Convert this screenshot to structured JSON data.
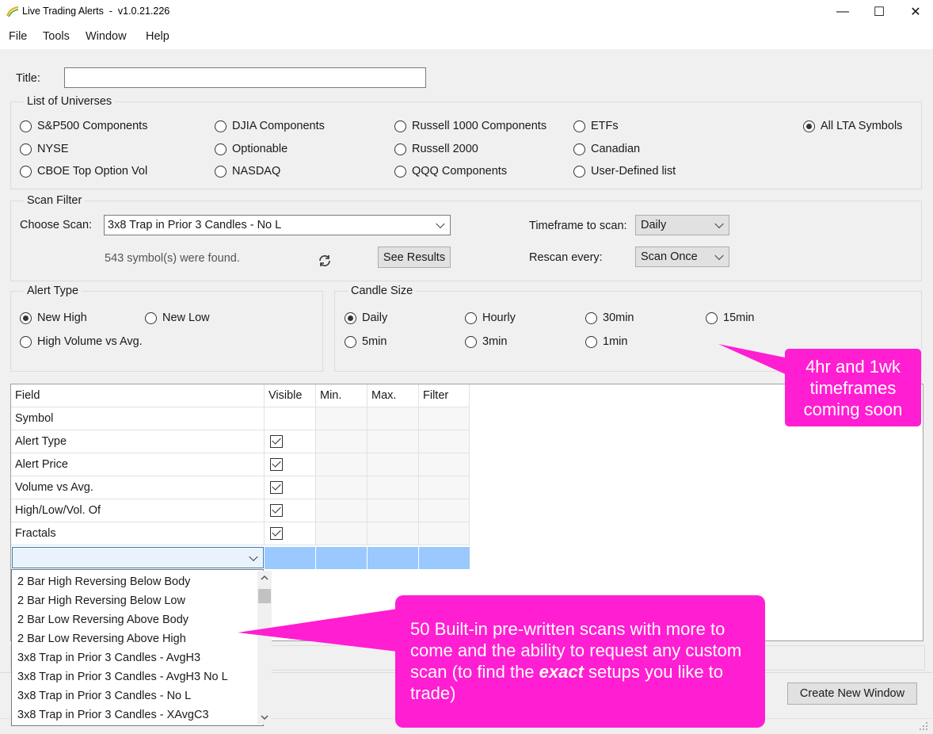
{
  "window": {
    "title": "Live Trading Alerts  -  v1.0.21.226",
    "controls": {
      "minimize": "—",
      "maximize": "☐",
      "close": "✕"
    }
  },
  "menu": [
    "File",
    "Tools",
    "Window",
    "Help"
  ],
  "title_field": {
    "label": "Title:",
    "value": ""
  },
  "universes": {
    "legend": "List of Universes",
    "options": [
      {
        "label": "S&P500 Components",
        "selected": false
      },
      {
        "label": "NYSE",
        "selected": false
      },
      {
        "label": "CBOE Top Option Vol",
        "selected": false
      },
      {
        "label": "DJIA Components",
        "selected": false
      },
      {
        "label": "Optionable",
        "selected": false
      },
      {
        "label": "NASDAQ",
        "selected": false
      },
      {
        "label": "Russell 1000 Components",
        "selected": false
      },
      {
        "label": "Russell 2000",
        "selected": false
      },
      {
        "label": "QQQ Components",
        "selected": false
      },
      {
        "label": "ETFs",
        "selected": false
      },
      {
        "label": "Canadian",
        "selected": false
      },
      {
        "label": "User-Defined list",
        "selected": false
      },
      {
        "label": "All LTA Symbols",
        "selected": true
      }
    ]
  },
  "scan_filter": {
    "legend": "Scan Filter",
    "choose_label": "Choose Scan:",
    "choose_value": "3x8 Trap in Prior 3 Candles - No L",
    "found_text": "543 symbol(s) were found.",
    "see_results": "See Results",
    "timeframe_label": "Timeframe to scan:",
    "timeframe_value": "Daily",
    "rescan_label": "Rescan every:",
    "rescan_value": "Scan Once"
  },
  "alert_type": {
    "legend": "Alert Type",
    "options": [
      {
        "label": "New High",
        "selected": true
      },
      {
        "label": "New Low",
        "selected": false
      },
      {
        "label": "High Volume vs Avg.",
        "selected": false
      }
    ]
  },
  "candle_size": {
    "legend": "Candle Size",
    "options": [
      {
        "label": "Daily",
        "selected": true
      },
      {
        "label": "Hourly",
        "selected": false
      },
      {
        "label": "30min",
        "selected": false
      },
      {
        "label": "15min",
        "selected": false
      },
      {
        "label": "5min",
        "selected": false
      },
      {
        "label": "3min",
        "selected": false
      },
      {
        "label": "1min",
        "selected": false
      }
    ]
  },
  "grid": {
    "headers": [
      "Field",
      "Visible",
      "Min.",
      "Max.",
      "Filter"
    ],
    "rows": [
      {
        "field": "Symbol",
        "visible": false
      },
      {
        "field": "Alert Type",
        "visible": true
      },
      {
        "field": "Alert Price",
        "visible": true
      },
      {
        "field": "Volume vs Avg.",
        "visible": true
      },
      {
        "field": "High/Low/Vol. Of",
        "visible": true
      },
      {
        "field": "Fractals",
        "visible": true
      }
    ]
  },
  "scan_dropdown": [
    "2 Bar High Reversing Below Body",
    "2 Bar High Reversing Below Low",
    "2 Bar Low Reversing Above Body",
    "2 Bar Low Reversing Above High",
    "3x8 Trap in Prior 3 Candles - AvgH3",
    "3x8 Trap in Prior 3 Candles - AvgH3 No L",
    "3x8 Trap in Prior 3 Candles - No L",
    "3x8 Trap in Prior 3 Candles - XAvgC3"
  ],
  "create_window_button": "Create New Window",
  "callouts": {
    "timeframes": [
      "4hr and 1wk",
      "timeframes",
      "coming soon"
    ],
    "scans": {
      "before_bold": "50 Built-in pre-written scans with more to come and the ability to request any custom scan (to find the ",
      "bold": "exact",
      "after_bold": " setups you like to trade)"
    }
  },
  "colors": {
    "callout": "#ff1ed2",
    "selection": "#99c9ff",
    "window_bg": "#f0f0f0"
  }
}
